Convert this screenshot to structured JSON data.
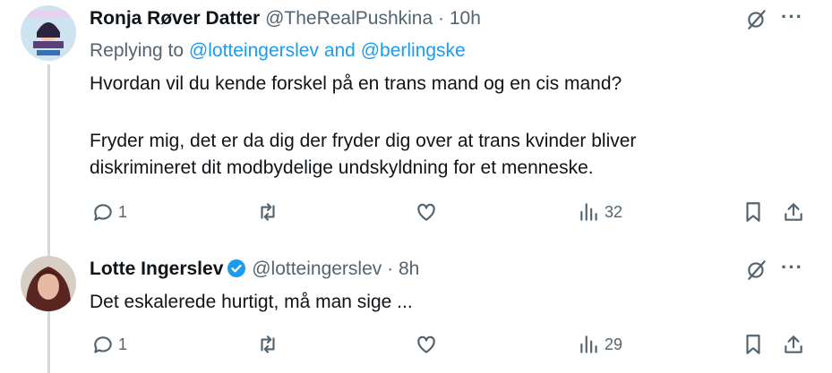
{
  "tweets": [
    {
      "name": "Ronja Røver Datter",
      "handle": "@TheRealPushkina",
      "separator": "·",
      "time": "10h",
      "replying_prefix": "Replying to",
      "mention1": "@lotteingerslev",
      "mention_join": "and",
      "mention2": "@berlingske",
      "lines": [
        "Hvordan vil du kende forskel på en trans mand og en cis mand?",
        "Fryder mig, det er da dig der fryder dig over at trans kvinder bliver",
        "diskrimineret dit modbydelige undskyldning for et menneske."
      ],
      "reply_count": "1",
      "views": "32",
      "icons": [
        "grok-icon",
        "more-icon",
        "reply-icon",
        "retweet-icon",
        "like-icon",
        "views-icon",
        "bookmark-icon",
        "share-icon"
      ]
    },
    {
      "name": "Lotte Ingerslev",
      "verified": true,
      "handle": "@lotteingerslev",
      "separator": "·",
      "time": "8h",
      "text": "Det eskalerede hurtigt, må man sige ...",
      "reply_count": "1",
      "views": "29"
    }
  ],
  "more_glyph": "···",
  "colors": {
    "link": "#1d9bf0",
    "muted": "#536471",
    "line": "#cfd9de",
    "text": "#0f1419"
  }
}
